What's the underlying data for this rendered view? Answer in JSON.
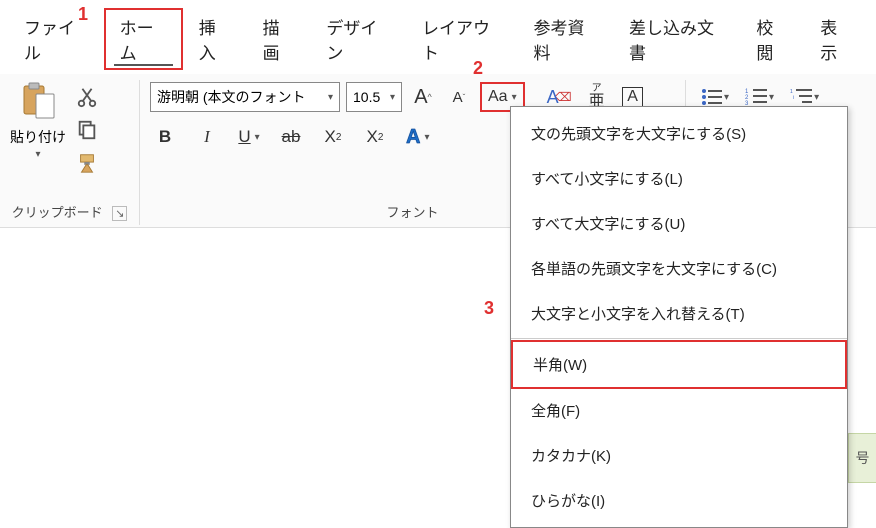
{
  "tabs": {
    "file": "ファイル",
    "home": "ホーム",
    "insert": "挿入",
    "draw": "描画",
    "design": "デザイン",
    "layout": "レイアウト",
    "references": "参考資料",
    "mailings": "差し込み文書",
    "review": "校閲",
    "view": "表示"
  },
  "annotations": {
    "a1": "1",
    "a2": "2",
    "a3": "3"
  },
  "clipboard": {
    "paste_label": "貼り付け",
    "group_label": "クリップボード"
  },
  "font": {
    "name": "游明朝 (本文のフォント",
    "size": "10.5",
    "group_label": "フォント",
    "change_case_label": "Aa",
    "buttons": {
      "bold": "B",
      "italic": "I",
      "underline": "U",
      "strike": "ab",
      "sub": "X",
      "sup": "X",
      "texteffect": "A"
    },
    "grow_font": "A",
    "shrink_font": "A",
    "clear_format_a": "A",
    "ruby_top": "ア",
    "ruby_bottom": "亜",
    "char_border": "A"
  },
  "change_case_menu": {
    "sentence": "文の先頭文字を大文字にする(S)",
    "lower": "すべて小文字にする(L)",
    "upper": "すべて大文字にする(U)",
    "cap_each": "各単語の先頭文字を大文字にする(C)",
    "toggle": "大文字と小文字を入れ替える(T)",
    "half": "半角(W)",
    "full": "全角(F)",
    "katakana": "カタカナ(K)",
    "hiragana": "ひらがな(I)"
  },
  "badge": {
    "text": "号"
  }
}
